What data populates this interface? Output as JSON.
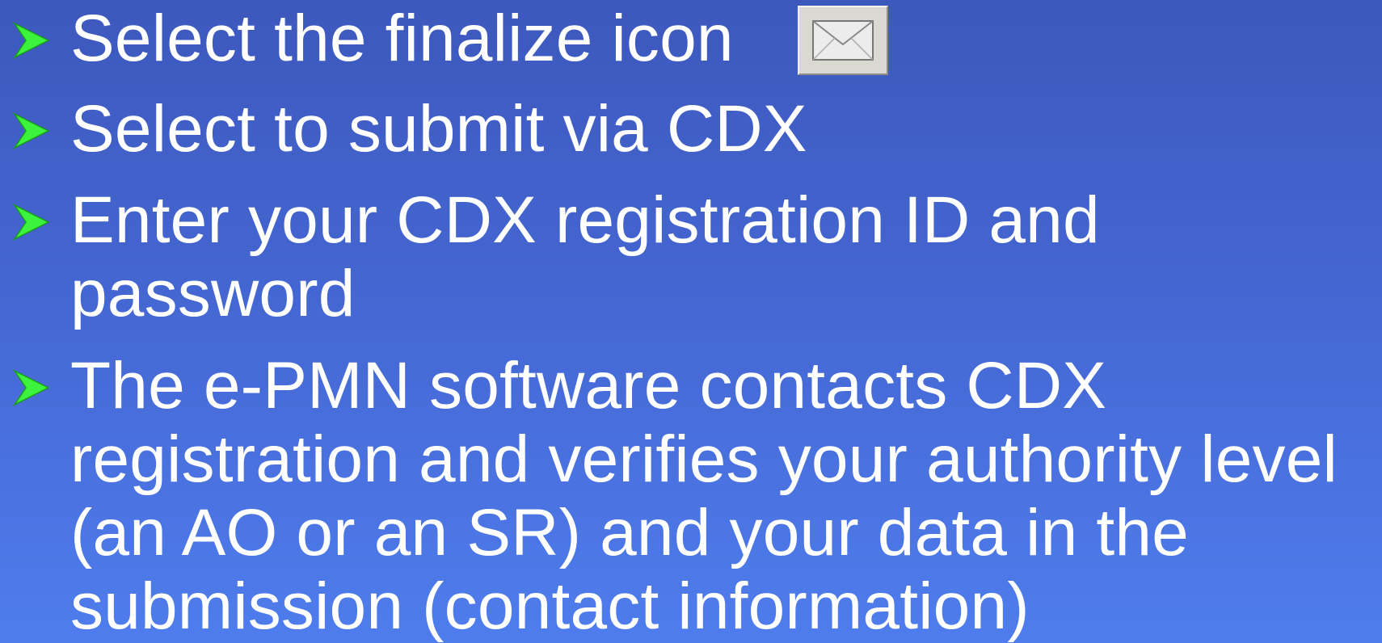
{
  "bullets": [
    {
      "text": "Select the finalize icon"
    },
    {
      "text": "Select to submit via CDX"
    },
    {
      "text": "Enter your CDX registration ID and\npassword"
    },
    {
      "text": "The e-PMN software contacts CDX\nregistration and verifies your authority level\n(an AO or an SR) and your data in the\nsubmission (contact information)"
    }
  ],
  "finalize_icon": {
    "icon": "envelope-icon"
  },
  "colors": {
    "background_top": "#3d58bd",
    "background_bottom": "#4f7ded",
    "text": "#ffffff",
    "bullet": "#33ff33"
  }
}
